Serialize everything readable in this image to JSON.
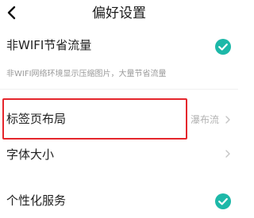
{
  "header": {
    "title": "偏好设置",
    "back_icon": "back-arrow-icon"
  },
  "settings": {
    "wifi_saver": {
      "label": "非WIFI节省流量",
      "enabled": true,
      "hint": "非WIFI网络环境显示压缩图片，大量节省流量"
    },
    "tab_layout": {
      "label": "标签页布局",
      "value": "瀑布流"
    },
    "font_size": {
      "label": "字体大小"
    },
    "personalized_service": {
      "label": "个性化服务",
      "enabled": true
    }
  },
  "colors": {
    "accent": "#1db8a8",
    "highlight_box": "#e5262c"
  }
}
